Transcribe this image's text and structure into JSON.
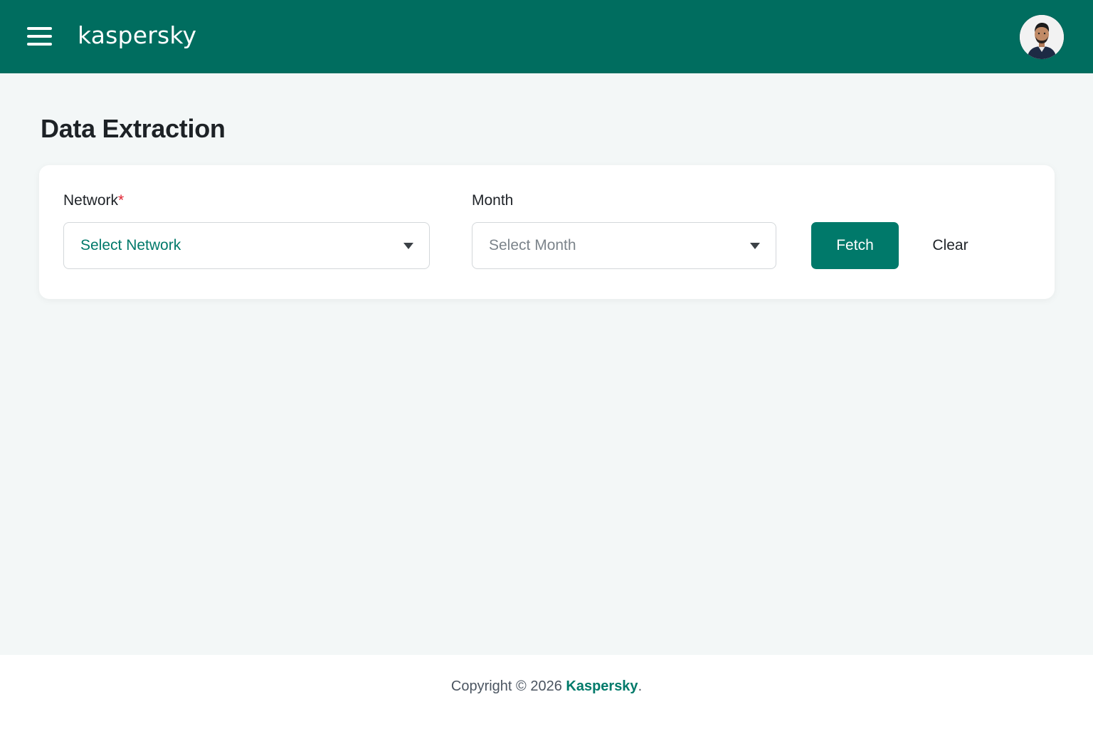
{
  "colors": {
    "brand_green": "#006d5f",
    "button_green": "#00796a",
    "required_red": "#e0202f",
    "page_background": "#f3f7f7"
  },
  "header": {
    "logo_text": "kaspersky",
    "menu_icon": "hamburger-menu-icon",
    "avatar_icon": "user-avatar"
  },
  "page": {
    "title": "Data Extraction"
  },
  "form": {
    "network": {
      "label": "Network",
      "required_marker": "*",
      "placeholder": "Select Network"
    },
    "month": {
      "label": "Month",
      "placeholder": "Select Month"
    },
    "fetch_label": "Fetch",
    "clear_label": "Clear"
  },
  "footer": {
    "copyright": "Copyright © 2026",
    "brand": "Kaspersky",
    "period": "."
  }
}
